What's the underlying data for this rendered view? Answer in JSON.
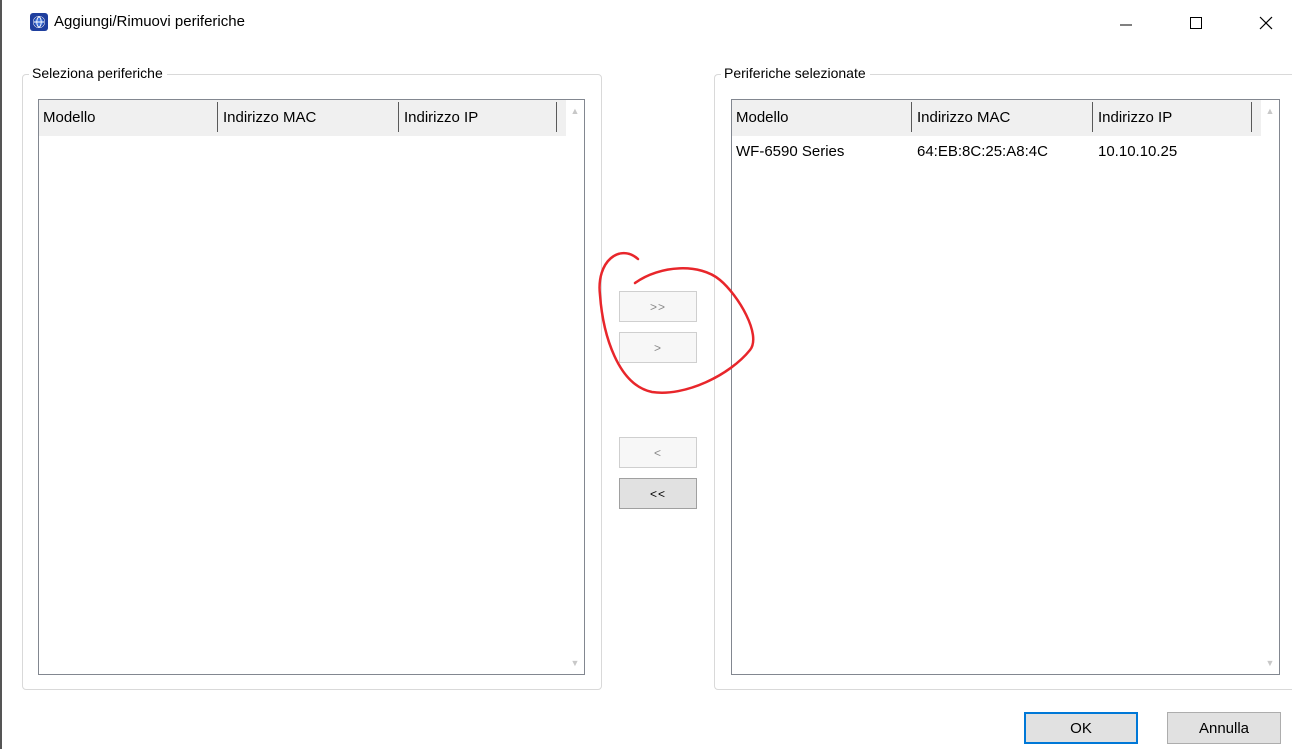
{
  "window": {
    "title": "Aggiungi/Rimuovi periferiche",
    "minimize_glyph": "—",
    "maximize_glyph": "☐",
    "close_glyph": "✕"
  },
  "left_panel": {
    "legend": "Seleziona periferiche",
    "columns": [
      "Modello",
      "Indirizzo MAC",
      "Indirizzo IP"
    ],
    "rows": []
  },
  "right_panel": {
    "legend": "Periferiche selezionate",
    "columns": [
      "Modello",
      "Indirizzo MAC",
      "Indirizzo IP"
    ],
    "rows": [
      {
        "model": "WF-6590 Series",
        "mac": "64:EB:8C:25:A8:4C",
        "ip": "10.10.10.25"
      }
    ]
  },
  "transfer_buttons": {
    "add_all": ">>",
    "add": ">",
    "remove": "<",
    "remove_all": "<<"
  },
  "dialog_buttons": {
    "ok": "OK",
    "cancel": "Annulla"
  },
  "annotation": {
    "color": "#e8262b"
  },
  "scroll_up_glyph": "▲",
  "scroll_down_glyph": "▼"
}
